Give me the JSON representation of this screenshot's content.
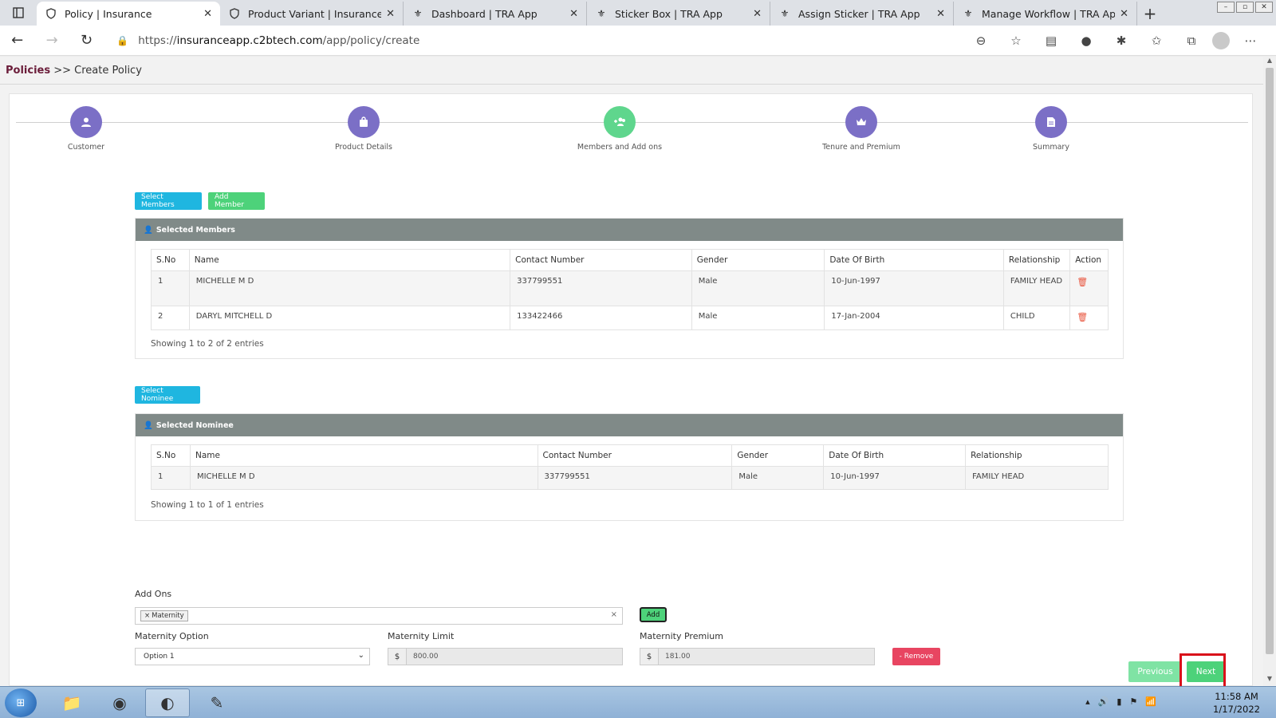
{
  "browser": {
    "tabs": [
      {
        "title": "Policy | Insurance",
        "icon": "shield-icon",
        "active": true
      },
      {
        "title": "Product Variant | Insurance",
        "icon": "shield-icon",
        "active": false
      },
      {
        "title": "Dashboard | TRA App",
        "icon": "emblem-icon",
        "active": false
      },
      {
        "title": "Sticker Box | TRA App",
        "icon": "emblem-icon",
        "active": false
      },
      {
        "title": "Assign Sticker | TRA App",
        "icon": "emblem-icon",
        "active": false
      },
      {
        "title": "Manage Workflow | TRA App",
        "icon": "emblem-icon",
        "active": false
      }
    ],
    "url_prefix": "https://",
    "url_host": "insuranceapp.c2btech.com",
    "url_path": "/app/policy/create"
  },
  "breadcrumb": {
    "root": "Policies",
    "separator": ">>",
    "current": "Create Policy"
  },
  "steps": [
    {
      "label": "Customer",
      "icon": "user-icon"
    },
    {
      "label": "Product Details",
      "icon": "bag-icon"
    },
    {
      "label": "Members and Add ons",
      "icon": "users-add-icon"
    },
    {
      "label": "Tenure and Premium",
      "icon": "crown-icon"
    },
    {
      "label": "Summary",
      "icon": "document-icon"
    }
  ],
  "buttons": {
    "select_members": "Select Members",
    "add_member": "Add Member",
    "select_nominee": "Select Nominee",
    "add": "Add",
    "remove": "- Remove",
    "previous": "Previous",
    "next": "Next"
  },
  "members": {
    "title": "Selected Members",
    "columns": [
      "S.No",
      "Name",
      "Contact Number",
      "Gender",
      "Date Of Birth",
      "Relationship",
      "Action"
    ],
    "rows": [
      {
        "sno": "1",
        "name": "MICHELLE M D",
        "contact": "337799551",
        "gender": "Male",
        "dob": "10-Jun-1997",
        "relationship": "FAMILY HEAD"
      },
      {
        "sno": "2",
        "name": "DARYL MITCHELL D",
        "contact": "133422466",
        "gender": "Male",
        "dob": "17-Jan-2004",
        "relationship": "CHILD"
      }
    ],
    "info": "Showing 1 to 2 of 2 entries"
  },
  "nominee": {
    "title": "Selected Nominee",
    "columns": [
      "S.No",
      "Name",
      "Contact Number",
      "Gender",
      "Date Of Birth",
      "Relationship"
    ],
    "rows": [
      {
        "sno": "1",
        "name": "MICHELLE M D",
        "contact": "337799551",
        "gender": "Male",
        "dob": "10-Jun-1997",
        "relationship": "FAMILY HEAD"
      }
    ],
    "info": "Showing 1 to 1 of 1 entries"
  },
  "addons": {
    "label": "Add Ons",
    "selected_tag": "Maternity",
    "tag_remove": "×",
    "clear": "×",
    "option_label": "Maternity Option",
    "option_value": "Option 1",
    "limit_label": "Maternity Limit",
    "limit_value": "800.00",
    "premium_label": "Maternity Premium",
    "premium_value": "181.00",
    "currency": "$"
  },
  "taskbar": {
    "time": "11:58 AM",
    "date": "1/17/2022"
  },
  "colors": {
    "step_purple": "#7b6fc6",
    "step_green": "#5fd68d",
    "btn_blue": "#1fb6e0",
    "btn_green": "#4dd27a",
    "btn_red": "#e84561",
    "panel_head": "#808a88",
    "highlight": "#d9101a"
  }
}
